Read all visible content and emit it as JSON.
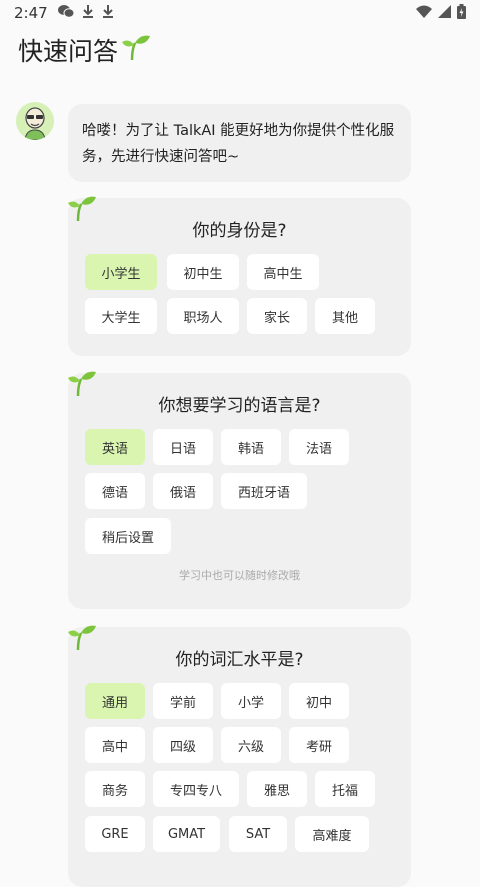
{
  "status": {
    "time": "2:47"
  },
  "header": {
    "title": "快速问答"
  },
  "intro": {
    "text": "哈喽！为了让 TalkAI 能更好地为你提供个性化服务，先进行快速问答吧~"
  },
  "q1": {
    "title": "你的身份是?",
    "options": [
      "小学生",
      "初中生",
      "高中生",
      "大学生",
      "职场人",
      "家长",
      "其他"
    ],
    "selected": "小学生"
  },
  "q2": {
    "title": "你想要学习的语言是?",
    "options": [
      "英语",
      "日语",
      "韩语",
      "法语",
      "德语",
      "俄语",
      "西班牙语",
      "稍后设置"
    ],
    "selected": "英语",
    "hint": "学习中也可以随时修改哦"
  },
  "q3": {
    "title": "你的词汇水平是?",
    "options": [
      "通用",
      "学前",
      "小学",
      "初中",
      "高中",
      "四级",
      "六级",
      "考研",
      "商务",
      "专四专八",
      "雅思",
      "托福",
      "GRE",
      "GMAT",
      "SAT",
      "高难度"
    ],
    "selected": "通用"
  },
  "colors": {
    "accent": "#d9f5b0",
    "card": "#f0f0f0",
    "sprout": "#7cc43c"
  }
}
